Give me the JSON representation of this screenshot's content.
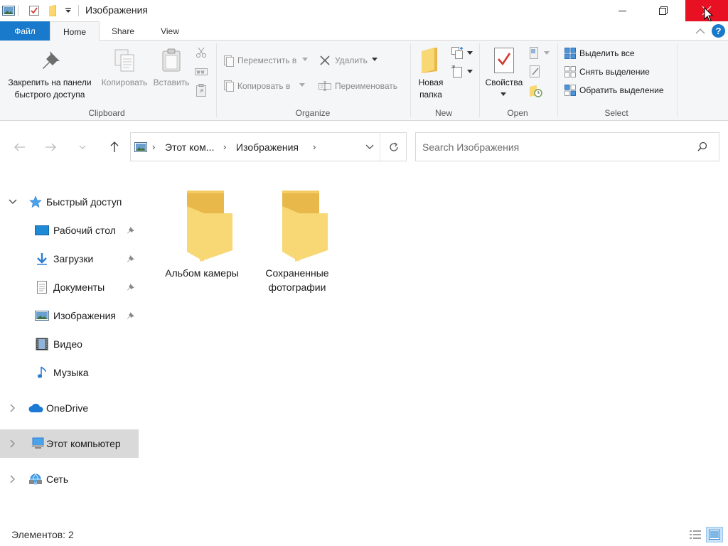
{
  "window": {
    "title": "Изображения"
  },
  "ribbon_tabs": {
    "file": "Файл",
    "home": "Home",
    "share": "Share",
    "view": "View"
  },
  "clipboard": {
    "pin_label_1": "Закрепить на панели",
    "pin_label_2": "быстрого доступа",
    "copy": "Копировать",
    "paste": "Вставить",
    "group": "Clipboard"
  },
  "organize": {
    "move_to": "Переместить в",
    "copy_to": "Копировать в",
    "delete": "Удалить",
    "rename": "Переименовать",
    "group": "Organize"
  },
  "new_group": {
    "new_folder_1": "Новая",
    "new_folder_2": "папка",
    "group": "New"
  },
  "open_group": {
    "properties": "Свойства",
    "group": "Open"
  },
  "select_group": {
    "select_all": "Выделить все",
    "select_none": "Снять выделение",
    "invert": "Обратить выделение",
    "group": "Select"
  },
  "address": {
    "crumb_1": "Этот ком...",
    "crumb_2": "Изображения"
  },
  "search": {
    "placeholder": "Search Изображения"
  },
  "nav": {
    "quick_access": "Быстрый доступ",
    "desktop": "Рабочий стол",
    "downloads": "Загрузки",
    "documents": "Документы",
    "pictures": "Изображения",
    "videos": "Видео",
    "music": "Музыка",
    "onedrive": "OneDrive",
    "this_pc": "Этот компьютер",
    "network": "Сеть"
  },
  "content": {
    "folders": [
      {
        "name": "Альбом камеры"
      },
      {
        "name_line_1": "Сохраненные",
        "name_line_2": "фотографии"
      }
    ]
  },
  "status": {
    "items": "Элементов: 2"
  },
  "colors": {
    "accent": "#1979ca",
    "close": "#e81123",
    "folder": "#f8d775",
    "folder_dark": "#e8b84a"
  }
}
